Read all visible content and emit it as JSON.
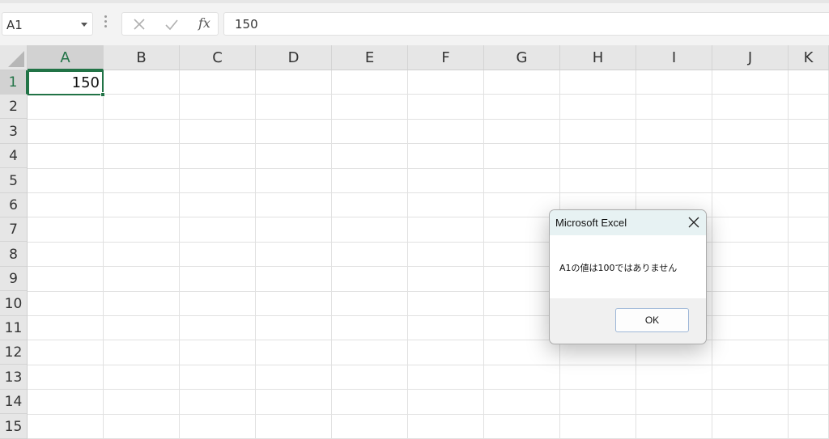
{
  "formula_bar": {
    "name_box": "A1",
    "fx_label": "fx",
    "formula_value": "150"
  },
  "grid": {
    "columns": [
      "A",
      "B",
      "C",
      "D",
      "E",
      "F",
      "G",
      "H",
      "I",
      "J",
      "K"
    ],
    "rows": [
      "1",
      "2",
      "3",
      "4",
      "5",
      "6",
      "7",
      "8",
      "9",
      "10",
      "11",
      "12",
      "13",
      "14",
      "15"
    ],
    "selected_column": "A",
    "selected_row": "1",
    "cells": {
      "A1": "150"
    }
  },
  "dialog": {
    "title": "Microsoft Excel",
    "message": "A1の値は100ではありません",
    "ok_label": "OK"
  },
  "colors": {
    "selection_accent": "#217346",
    "header_bg": "#e6e6e6",
    "gridline": "#e1e1e1",
    "dialog_titlebar": "#e7f2f3"
  },
  "icons": {
    "cancel": "close-x-icon",
    "enter": "checkmark-icon",
    "function": "fx-icon",
    "dialog_close": "close-icon",
    "name_box_dropdown": "chevron-down-icon"
  }
}
